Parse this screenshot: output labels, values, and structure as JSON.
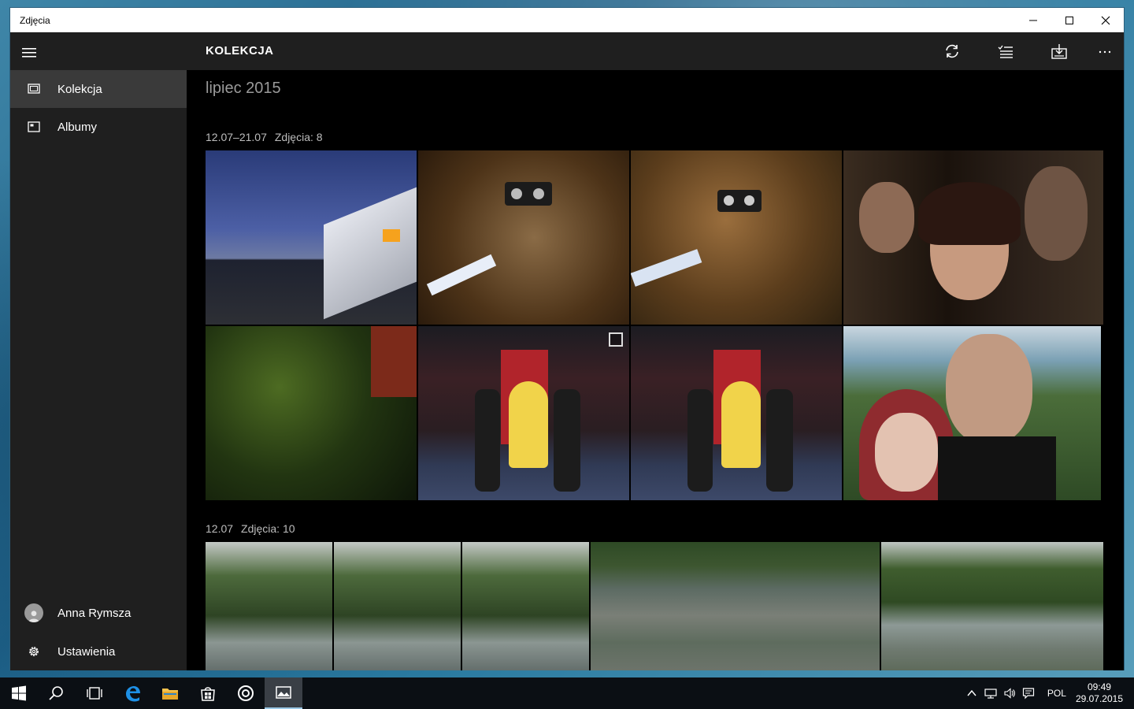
{
  "window": {
    "title": "Zdjęcia",
    "minimize_icon": "minimize-icon",
    "maximize_icon": "maximize-icon",
    "close_icon": "close-icon"
  },
  "sidebar": {
    "menu_icon": "hamburger-icon",
    "items": [
      {
        "label": "Kolekcja",
        "icon": "collection-icon",
        "active": true
      },
      {
        "label": "Albumy",
        "icon": "albums-icon",
        "active": false
      }
    ],
    "user": {
      "label": "Anna Rymsza",
      "icon": "user-avatar-icon"
    },
    "settings": {
      "label": "Ustawienia",
      "icon": "gear-icon"
    }
  },
  "appbar": {
    "title": "KOLEKCJA",
    "buttons": [
      {
        "name": "refresh",
        "icon": "refresh-icon"
      },
      {
        "name": "select",
        "icon": "select-list-icon"
      },
      {
        "name": "import",
        "icon": "import-icon"
      },
      {
        "name": "more",
        "icon": "more-icon"
      }
    ]
  },
  "collection": {
    "month": "lipiec 2015",
    "groups": [
      {
        "date": "12.07–21.07",
        "count": "Zdjęcia: 8"
      },
      {
        "date": "12.07",
        "count": "Zdjęcia: 10"
      }
    ]
  },
  "taskbar": {
    "apps": [
      {
        "name": "start",
        "icon": "windows-start-icon"
      },
      {
        "name": "search",
        "icon": "search-icon"
      },
      {
        "name": "task-view",
        "icon": "task-view-icon"
      },
      {
        "name": "edge",
        "icon": "edge-icon"
      },
      {
        "name": "file-explorer",
        "icon": "folder-icon"
      },
      {
        "name": "store",
        "icon": "store-icon"
      },
      {
        "name": "media",
        "icon": "media-player-icon"
      },
      {
        "name": "photos",
        "icon": "photos-icon",
        "active": true
      }
    ],
    "tray": {
      "language": "POL",
      "time": "09:49",
      "date": "29.07.2015"
    }
  },
  "colors": {
    "sidebar_bg": "#1f1f1f",
    "active_item_bg": "#3a3a3a",
    "content_bg": "#000000",
    "taskbar_bg": "#0b0f14"
  }
}
